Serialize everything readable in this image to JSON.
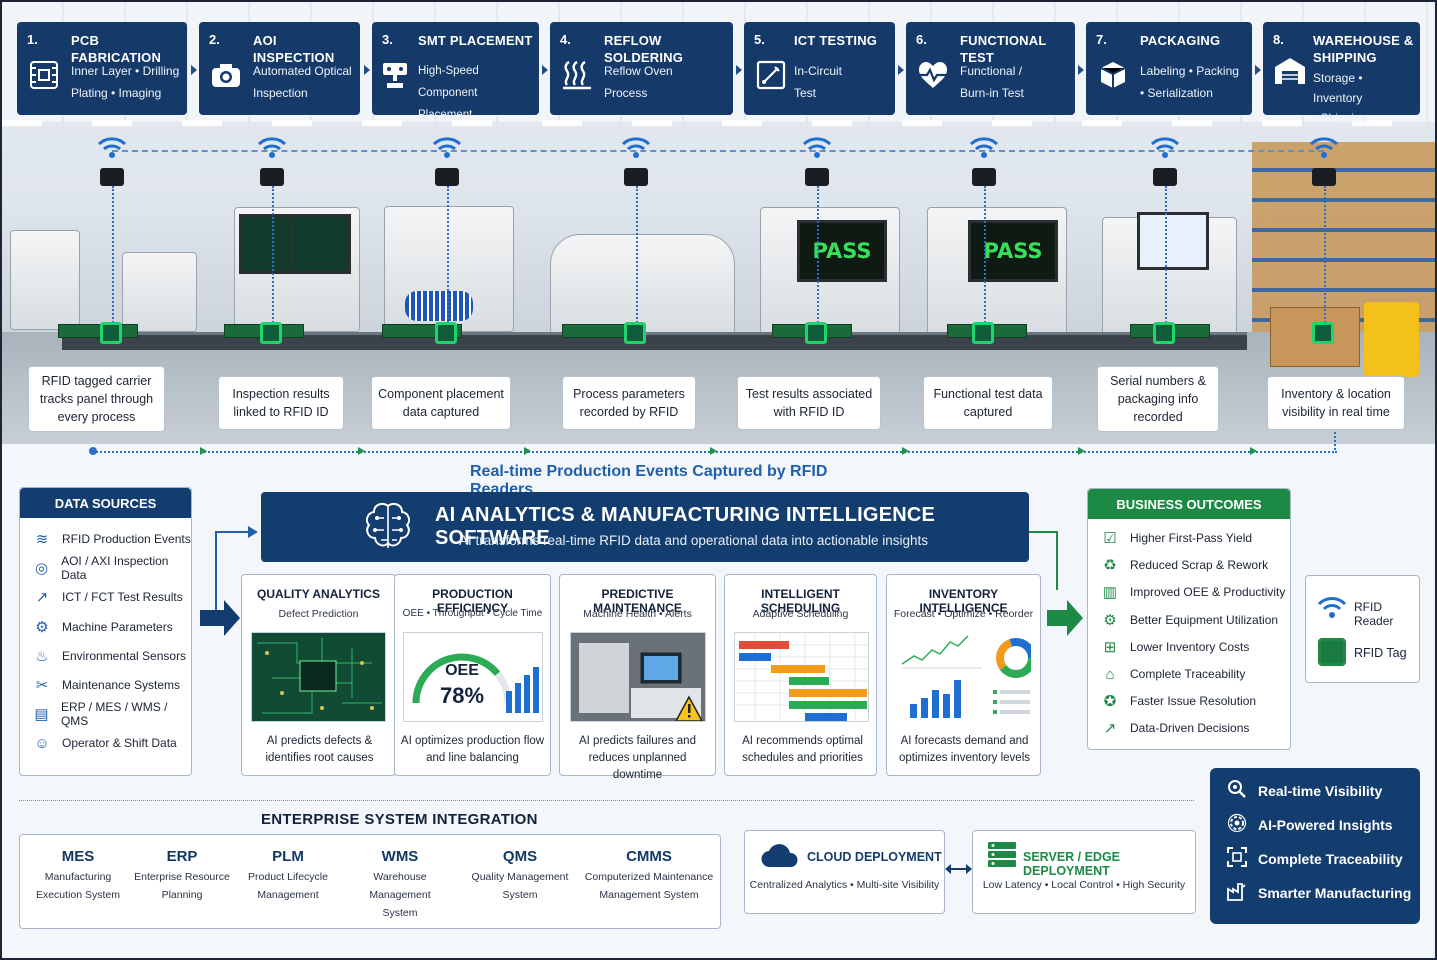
{
  "stages": [
    {
      "num": "1.",
      "title": "PCB FABRICATION",
      "desc": [
        "Inner Layer • Drilling",
        "Plating • Imaging"
      ],
      "icon": "pcb-icon",
      "caption": "RFID tagged carrier tracks panel through every process"
    },
    {
      "num": "2.",
      "title": "AOI INSPECTION",
      "desc": [
        "Automated Optical",
        "Inspection"
      ],
      "icon": "camera-icon",
      "caption": "Inspection results linked to RFID ID"
    },
    {
      "num": "3.",
      "title": "SMT PLACEMENT",
      "desc": [
        "High-Speed Component",
        "Placement"
      ],
      "icon": "pick-place-icon",
      "caption": "Component placement data captured"
    },
    {
      "num": "4.",
      "title": "REFLOW SOLDERING",
      "desc": [
        "Reflow Oven",
        "Process"
      ],
      "icon": "heat-icon",
      "caption": "Process parameters recorded by RFID"
    },
    {
      "num": "5.",
      "title": "ICT TESTING",
      "desc": [
        "In-Circuit",
        "Test"
      ],
      "icon": "probe-icon",
      "caption": "Test results associated with RFID ID"
    },
    {
      "num": "6.",
      "title": "FUNCTIONAL TEST",
      "desc": [
        "Functional /",
        "Burn-in Test"
      ],
      "icon": "pulse-icon",
      "caption": "Functional test data captured"
    },
    {
      "num": "7.",
      "title": "PACKAGING",
      "desc": [
        "Labeling • Packing",
        "• Serialization"
      ],
      "icon": "box-icon",
      "caption": "Serial numbers & packaging info recorded"
    },
    {
      "num": "8.",
      "title": "WAREHOUSE & SHIPPING",
      "desc": [
        "Storage • Inventory",
        "• Shipping"
      ],
      "icon": "warehouse-icon",
      "caption": "Inventory & location visibility in real time"
    }
  ],
  "screens": {
    "pass_1": "PASS",
    "pass_2": "PASS"
  },
  "rt_caption": "Real-time Production Events Captured by RFID Readers",
  "data_sources": {
    "title": "DATA SOURCES",
    "items": [
      {
        "label": "RFID Production Events",
        "icon": "wifi-icon"
      },
      {
        "label": "AOI / AXI Inspection Data",
        "icon": "camera-icon"
      },
      {
        "label": "ICT / FCT Test Results",
        "icon": "chart-icon"
      },
      {
        "label": "Machine Parameters",
        "icon": "gear-icon"
      },
      {
        "label": "Environmental Sensors",
        "icon": "thermometer-icon"
      },
      {
        "label": "Maintenance Systems",
        "icon": "wrench-icon"
      },
      {
        "label": "ERP / MES / WMS / QMS",
        "icon": "database-icon"
      },
      {
        "label": "Operator & Shift Data",
        "icon": "user-icon"
      }
    ]
  },
  "ai": {
    "title": "AI ANALYTICS & MANUFACTURING INTELLIGENCE SOFTWARE",
    "subtitle": "AI transforms real-time RFID data and operational data into actionable insights"
  },
  "cards": [
    {
      "title": "QUALITY ANALYTICS",
      "sub": "Defect Prediction",
      "desc": "AI predicts defects & identifies root causes"
    },
    {
      "title": "PRODUCTION EFFICIENCY",
      "sub": "OEE • Throughput • Cycle Time",
      "desc": "AI optimizes production flow and line balancing",
      "oee_label": "OEE",
      "oee_value": "78%",
      "oee_fraction": 0.78
    },
    {
      "title": "PREDICTIVE MAINTENANCE",
      "sub": "Machine Health • Alerts",
      "desc": "AI predicts failures and reduces unplanned downtime"
    },
    {
      "title": "INTELLIGENT SCHEDULING",
      "sub": "Adaptive Scheduling",
      "desc": "AI recommends optimal schedules and priorities"
    },
    {
      "title": "INVENTORY INTELLIGENCE",
      "sub": "Forecast • Optimize • Reorder",
      "desc": "AI forecasts demand and optimizes inventory levels"
    }
  ],
  "outcomes": {
    "title": "BUSINESS OUTCOMES",
    "items": [
      {
        "label": "Higher First-Pass Yield",
        "icon": "check-icon"
      },
      {
        "label": "Reduced Scrap & Rework",
        "icon": "recycle-icon"
      },
      {
        "label": "Improved OEE & Productivity",
        "icon": "bar-chart-icon"
      },
      {
        "label": "Better Equipment Utilization",
        "icon": "gear-user-icon"
      },
      {
        "label": "Lower Inventory Costs",
        "icon": "cart-icon"
      },
      {
        "label": "Complete Traceability",
        "icon": "trace-icon"
      },
      {
        "label": "Faster Issue Resolution",
        "icon": "bulb-icon"
      },
      {
        "label": "Data-Driven Decisions",
        "icon": "trend-icon"
      }
    ]
  },
  "legend": {
    "reader": "RFID Reader",
    "tag": "RFID Tag"
  },
  "esi": {
    "title": "ENTERPRISE SYSTEM INTEGRATION",
    "systems": [
      {
        "name": "MES",
        "desc": [
          "Manufacturing",
          "Execution System"
        ]
      },
      {
        "name": "ERP",
        "desc": [
          "Enterprise Resource",
          "Planning"
        ]
      },
      {
        "name": "PLM",
        "desc": [
          "Product Lifecycle",
          "Management"
        ]
      },
      {
        "name": "WMS",
        "desc": [
          "Warehouse Management",
          "System"
        ]
      },
      {
        "name": "QMS",
        "desc": [
          "Quality Management",
          "System"
        ]
      },
      {
        "name": "CMMS",
        "desc": [
          "Computerized Maintenance",
          "Management System"
        ]
      }
    ]
  },
  "cloud": {
    "title": "CLOUD DEPLOYMENT",
    "desc": "Centralized Analytics • Multi-site Visibility"
  },
  "edge": {
    "title": "SERVER / EDGE DEPLOYMENT",
    "desc": "Low Latency • Local Control • High Security"
  },
  "summary": [
    {
      "label": "Real-time Visibility",
      "icon": "eye-search-icon"
    },
    {
      "label": "AI-Powered Insights",
      "icon": "ai-gear-icon"
    },
    {
      "label": "Complete Traceability",
      "icon": "scan-icon"
    },
    {
      "label": "Smarter Manufacturing",
      "icon": "factory-icon"
    }
  ],
  "colors": {
    "navy": "#133d6e",
    "green": "#1c8a44",
    "blue": "#1f5fae",
    "rfid_green": "#1fd36d"
  }
}
